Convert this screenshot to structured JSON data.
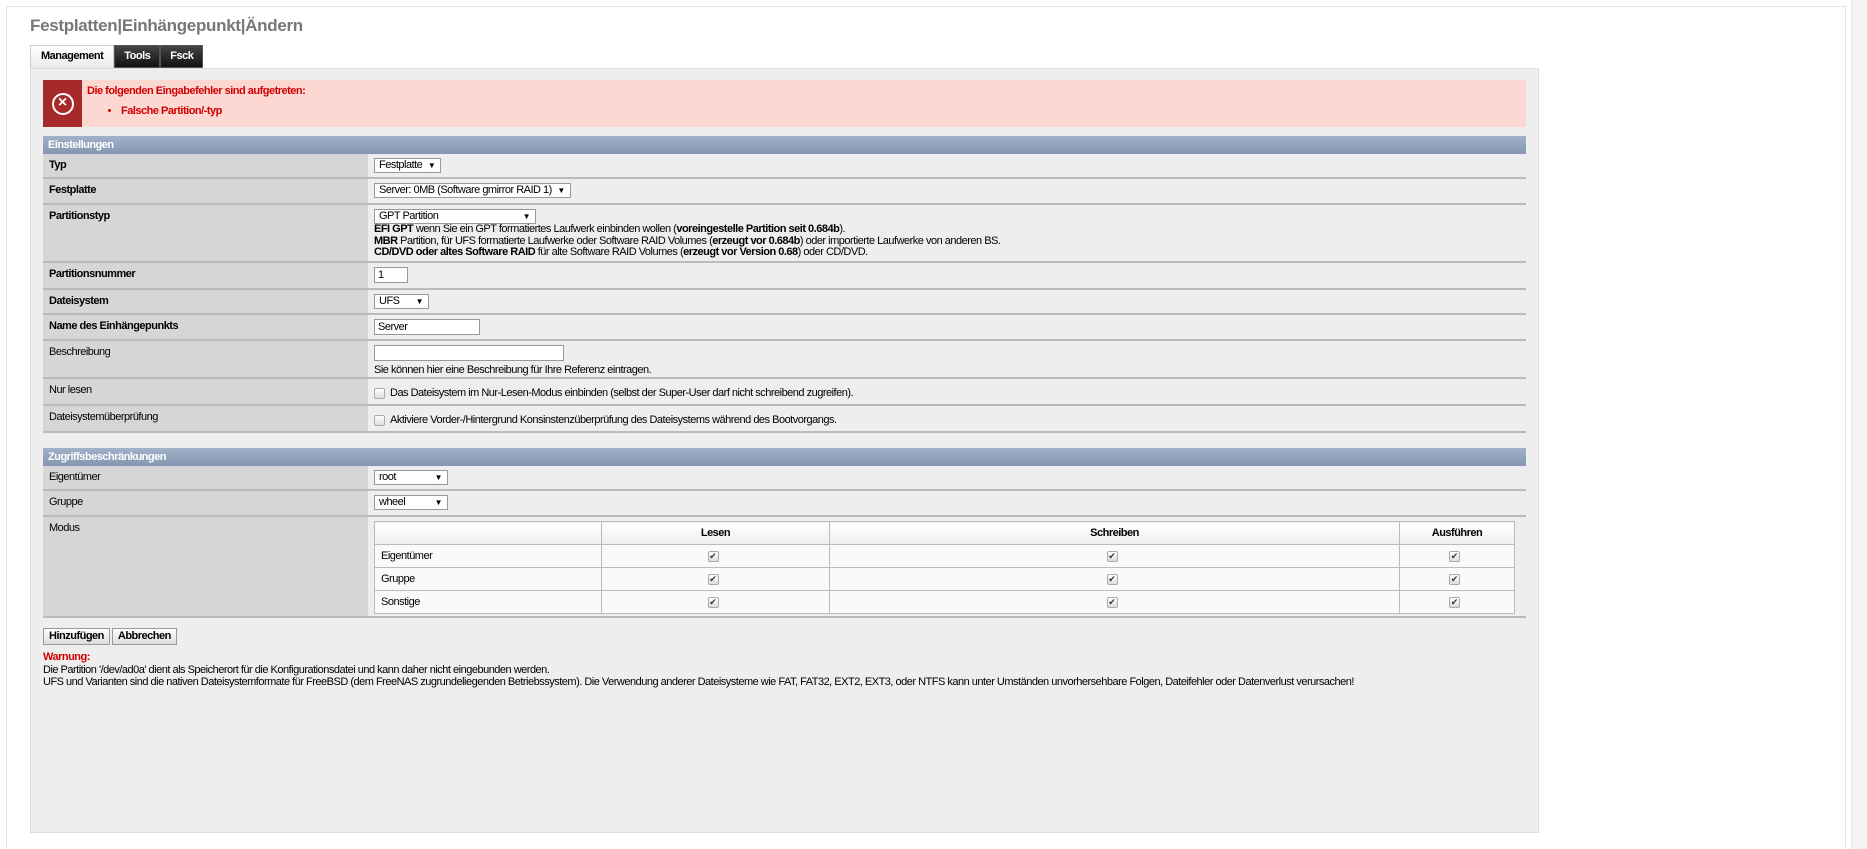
{
  "title": "Festplatten|Einhängepunkt|Ändern",
  "tabs": [
    "Management",
    "Tools",
    "Fsck"
  ],
  "error": {
    "heading": "Die folgenden Eingabefehler sind aufgetreten:",
    "items": [
      "Falsche Partition/-typ"
    ]
  },
  "settings": {
    "header": "Einstellungen",
    "typ": {
      "label": "Typ",
      "value": "Festplatte"
    },
    "festplatte": {
      "label": "Festplatte",
      "value": "Server: 0MB (Software gmirror RAID 1)"
    },
    "partitionstyp": {
      "label": "Partitionstyp",
      "value": "GPT Partition",
      "h1b": "EFI GPT",
      "h1a": " wenn Sie ein GPT formatiertes Laufwerk einbinden wollen (",
      "h1c": "voreingestelle Partition seit 0.684b",
      "h1d": ").",
      "h2b": "MBR",
      "h2a": " Partition, für UFS formatierte Laufwerke oder Software RAID Volumes (",
      "h2c": "erzeugt vor 0.684b",
      "h2d": ") oder importierte Laufwerke von anderen BS.",
      "h3b": "CD/DVD oder altes Software RAID",
      "h3a": " für alte Software RAID Volumes (",
      "h3c": "erzeugt vor Version 0.68",
      "h3d": ") oder CD/DVD."
    },
    "partitionsnummer": {
      "label": "Partitionsnummer",
      "value": "1"
    },
    "dateisystem": {
      "label": "Dateisystem",
      "value": "UFS"
    },
    "name": {
      "label": "Name des Einhängepunkts",
      "value": "Server"
    },
    "beschreibung": {
      "label": "Beschreibung",
      "value": "",
      "hint": "Sie können hier eine Beschreibung für Ihre Referenz eintragen."
    },
    "nurlesen": {
      "label": "Nur lesen",
      "text": "Das Dateisystem im Nur-Lesen-Modus einbinden (selbst der Super-User darf nicht schreibend zugreifen).",
      "checked": false
    },
    "fsck": {
      "label": "Dateisystemüberprüfung",
      "text": "Aktiviere Vorder-/Hintergrund Konsinstenzüberprüfung des Dateisystems während des Bootvorgangs.",
      "checked": false
    }
  },
  "access": {
    "header": "Zugriffsbeschränkungen",
    "owner": {
      "label": "Eigentümer",
      "value": "root"
    },
    "group": {
      "label": "Gruppe",
      "value": "wheel"
    },
    "mode": {
      "label": "Modus",
      "columns": [
        "Lesen",
        "Schreiben",
        "Ausführen"
      ],
      "rows": [
        {
          "name": "Eigentümer",
          "perms": [
            true,
            true,
            true
          ]
        },
        {
          "name": "Gruppe",
          "perms": [
            true,
            true,
            true
          ]
        },
        {
          "name": "Sonstige",
          "perms": [
            true,
            true,
            true
          ]
        }
      ]
    }
  },
  "buttons": {
    "add": "Hinzufügen",
    "cancel": "Abbrechen"
  },
  "warning": {
    "title": "Warnung:",
    "line1": "Die Partition '/dev/ad0a' dient als Speicherort für die Konfigurationsdatei und kann daher nicht eingebunden werden.",
    "line2": "UFS und Varianten sind die nativen Dateisystemformate für FreeBSD (dem FreeNAS zugrundeliegenden Betriebssystem). Die Verwendung anderer Dateisysteme wie FAT, FAT32, EXT2, EXT3, oder NTFS kann unter Umständen unvorhersehbare Folgen, Dateifehler oder Datenverlust verursachen!"
  },
  "colors": {
    "error": "#d10000",
    "error_icon_bg": "#a62a2a",
    "section_header": "#8fa1bb"
  }
}
